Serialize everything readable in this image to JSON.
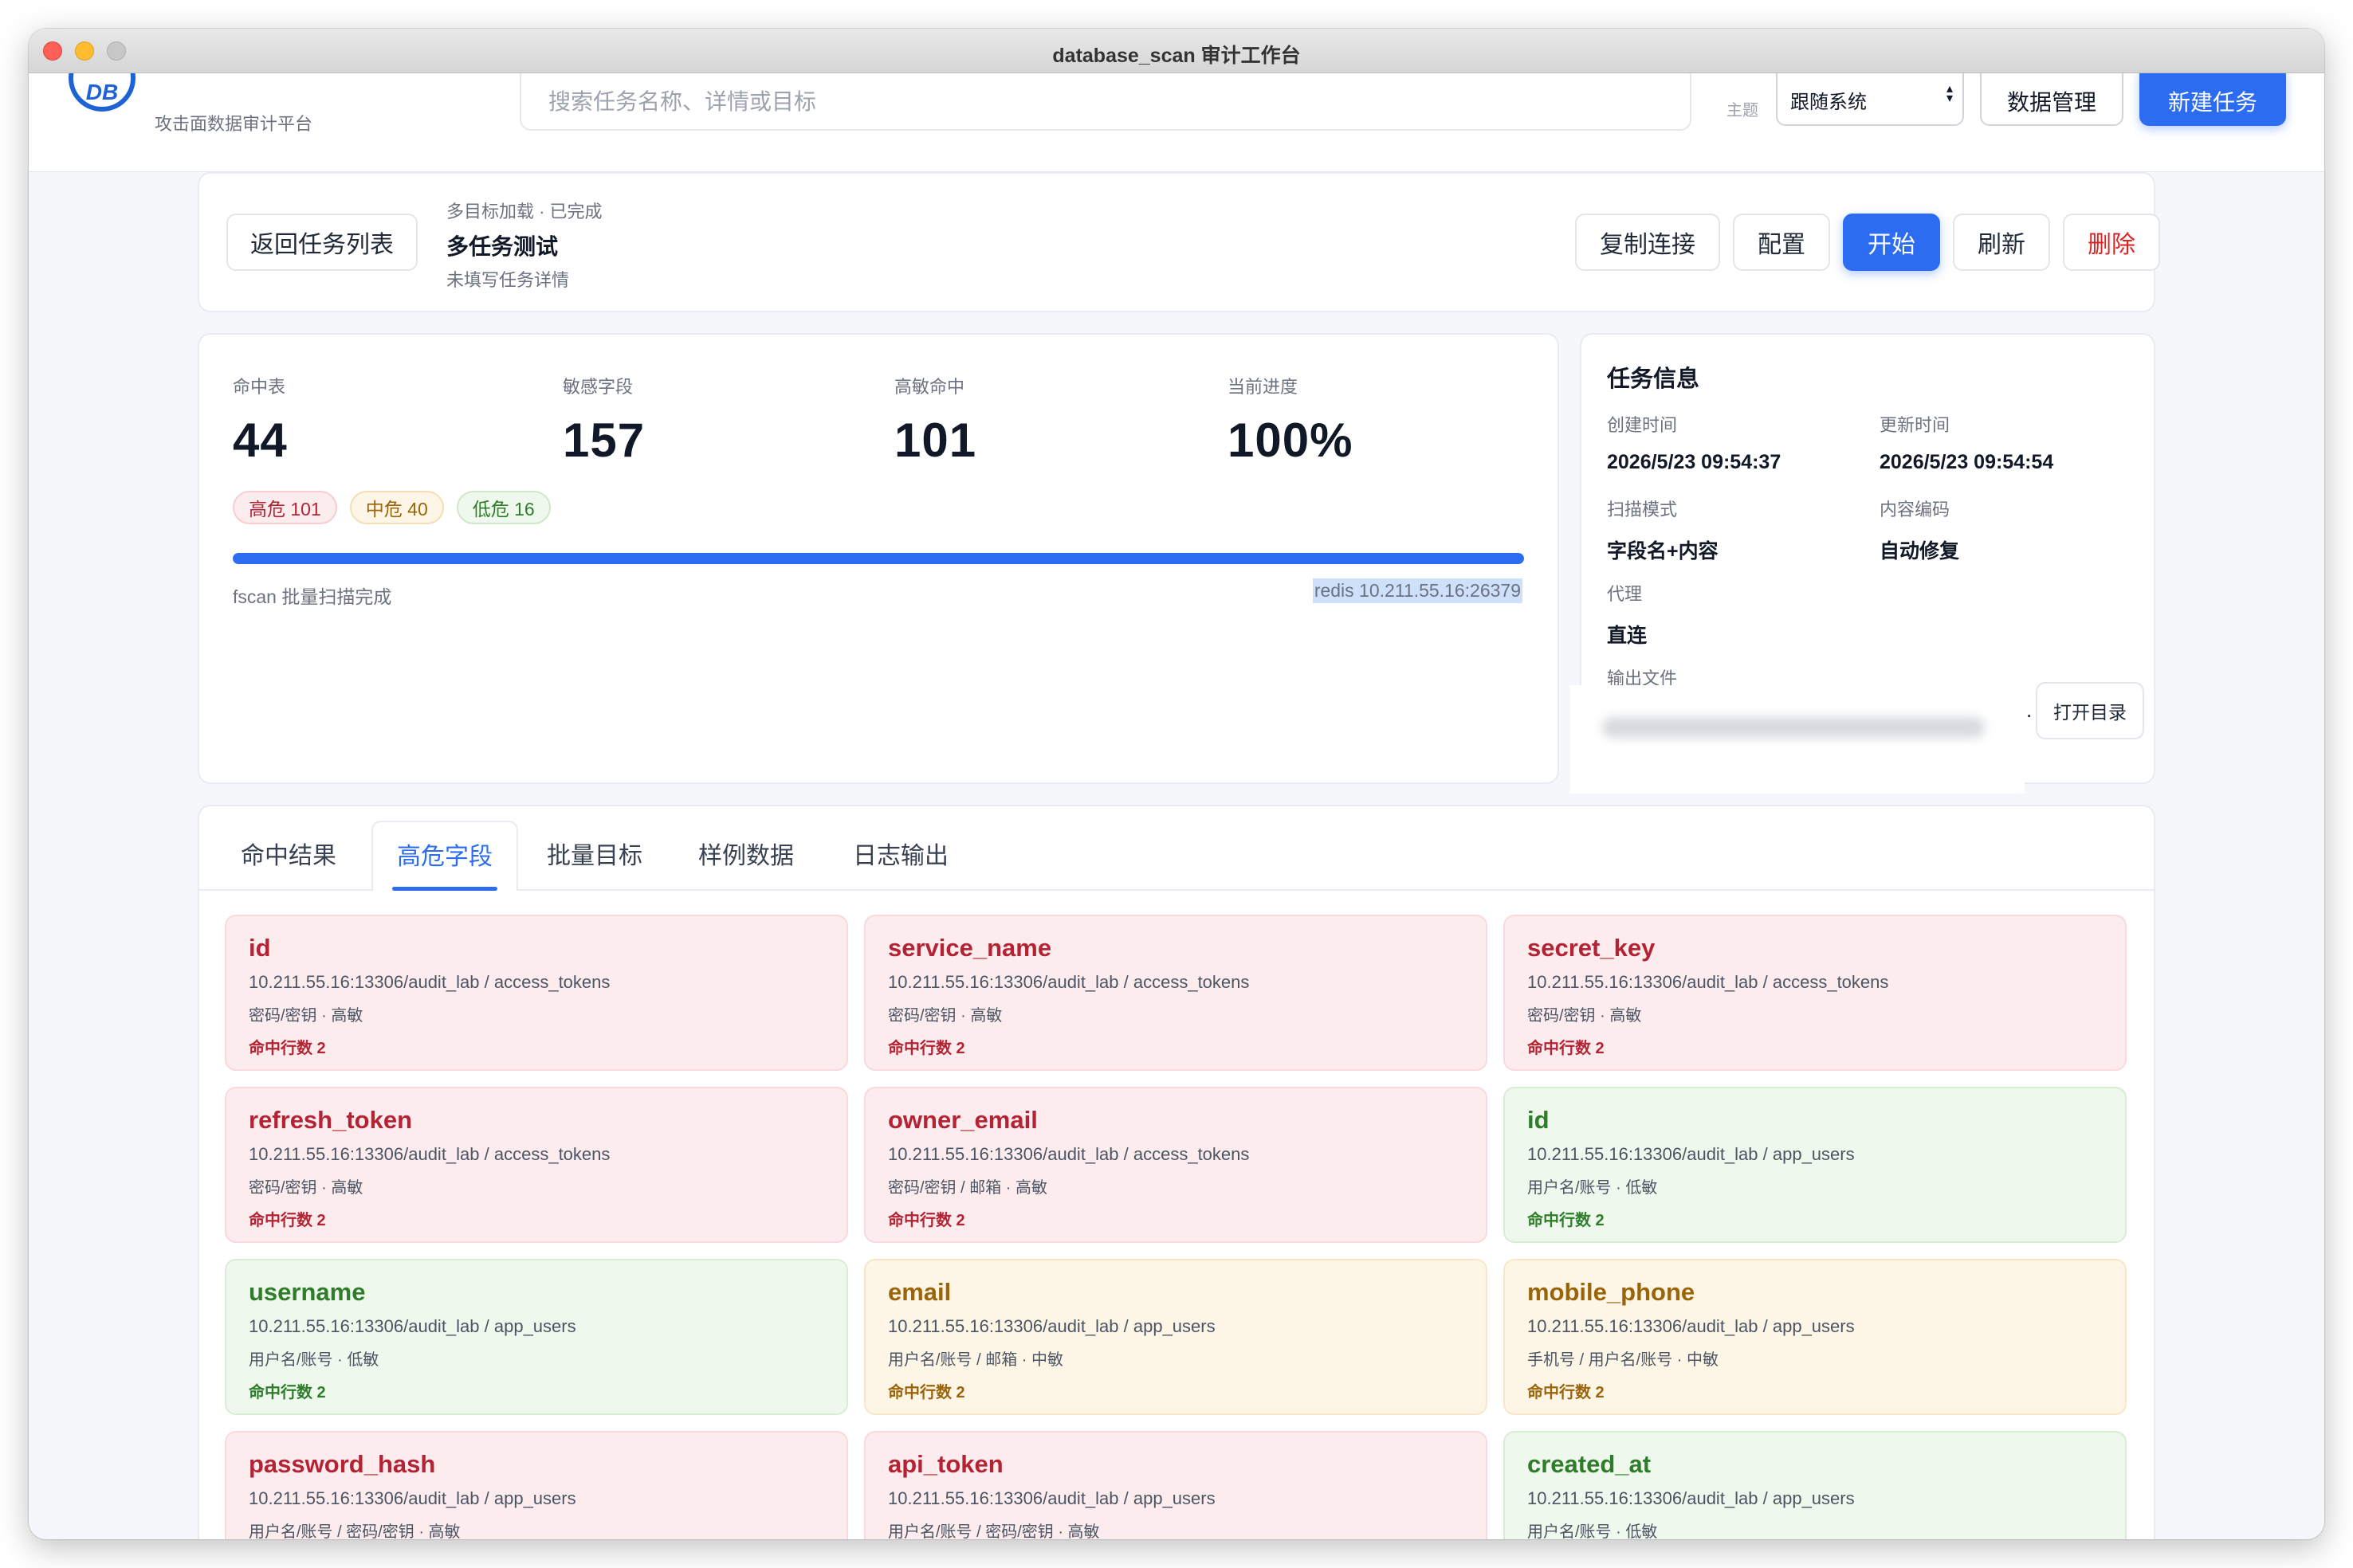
{
  "window": {
    "title": "database_scan 审计工作台"
  },
  "topbar": {
    "logo_text": "DB",
    "brand_subtitle": "攻击面数据审计平台",
    "search_placeholder": "搜索任务名称、详情或目标",
    "theme_label": "主题",
    "theme_value": "跟随系统",
    "data_manage_label": "数据管理",
    "new_task_label": "新建任务"
  },
  "task_header": {
    "back_label": "返回任务列表",
    "meta": "多目标加载 · 已完成",
    "title": "多任务测试",
    "description": "未填写任务详情",
    "buttons": {
      "copy": "复制连接",
      "config": "配置",
      "start": "开始",
      "refresh": "刷新",
      "delete": "删除"
    }
  },
  "stats": {
    "items": [
      {
        "label": "命中表",
        "value": "44"
      },
      {
        "label": "敏感字段",
        "value": "157"
      },
      {
        "label": "高敏命中",
        "value": "101"
      },
      {
        "label": "当前进度",
        "value": "100%"
      }
    ],
    "badges": {
      "high": "高危 101",
      "mid": "中危 40",
      "low": "低危 16"
    },
    "progress_fraction": 1.0,
    "progress_text": "fscan 批量扫描完成",
    "progress_target": "redis 10.211.55.16:26379"
  },
  "task_info": {
    "title": "任务信息",
    "created_label": "创建时间",
    "created_value": "2026/5/23 09:54:37",
    "updated_label": "更新时间",
    "updated_value": "2026/5/23 09:54:54",
    "scan_mode_label": "扫描模式",
    "scan_mode_value": "字段名+内容",
    "encoding_label": "内容编码",
    "encoding_value": "自动修复",
    "proxy_label": "代理",
    "proxy_value": "直连",
    "output_label": "输出文件",
    "output_suffix": ".",
    "open_dir_label": "打开目录"
  },
  "tabs": [
    "命中结果",
    "高危字段",
    "批量目标",
    "样例数据",
    "日志输出"
  ],
  "active_tab": 1,
  "fields": [
    {
      "name": "id",
      "path": "10.211.55.16:13306/audit_lab / access_tokens",
      "type": "密码/密钥 · 高敏",
      "count": "命中行数 2",
      "level": "high"
    },
    {
      "name": "service_name",
      "path": "10.211.55.16:13306/audit_lab / access_tokens",
      "type": "密码/密钥 · 高敏",
      "count": "命中行数 2",
      "level": "high"
    },
    {
      "name": "secret_key",
      "path": "10.211.55.16:13306/audit_lab / access_tokens",
      "type": "密码/密钥 · 高敏",
      "count": "命中行数 2",
      "level": "high"
    },
    {
      "name": "refresh_token",
      "path": "10.211.55.16:13306/audit_lab / access_tokens",
      "type": "密码/密钥 · 高敏",
      "count": "命中行数 2",
      "level": "high"
    },
    {
      "name": "owner_email",
      "path": "10.211.55.16:13306/audit_lab / access_tokens",
      "type": "密码/密钥 / 邮箱 · 高敏",
      "count": "命中行数 2",
      "level": "high"
    },
    {
      "name": "id",
      "path": "10.211.55.16:13306/audit_lab / app_users",
      "type": "用户名/账号 · 低敏",
      "count": "命中行数 2",
      "level": "low"
    },
    {
      "name": "username",
      "path": "10.211.55.16:13306/audit_lab / app_users",
      "type": "用户名/账号 · 低敏",
      "count": "命中行数 2",
      "level": "low"
    },
    {
      "name": "email",
      "path": "10.211.55.16:13306/audit_lab / app_users",
      "type": "用户名/账号 / 邮箱 · 中敏",
      "count": "命中行数 2",
      "level": "mid"
    },
    {
      "name": "mobile_phone",
      "path": "10.211.55.16:13306/audit_lab / app_users",
      "type": "手机号 / 用户名/账号 · 中敏",
      "count": "命中行数 2",
      "level": "mid"
    },
    {
      "name": "password_hash",
      "path": "10.211.55.16:13306/audit_lab / app_users",
      "type": "用户名/账号 / 密码/密钥 · 高敏",
      "count": "",
      "level": "high"
    },
    {
      "name": "api_token",
      "path": "10.211.55.16:13306/audit_lab / app_users",
      "type": "用户名/账号 / 密码/密钥 · 高敏",
      "count": "",
      "level": "high"
    },
    {
      "name": "created_at",
      "path": "10.211.55.16:13306/audit_lab / app_users",
      "type": "用户名/账号 · 低敏",
      "count": "",
      "level": "low"
    }
  ]
}
